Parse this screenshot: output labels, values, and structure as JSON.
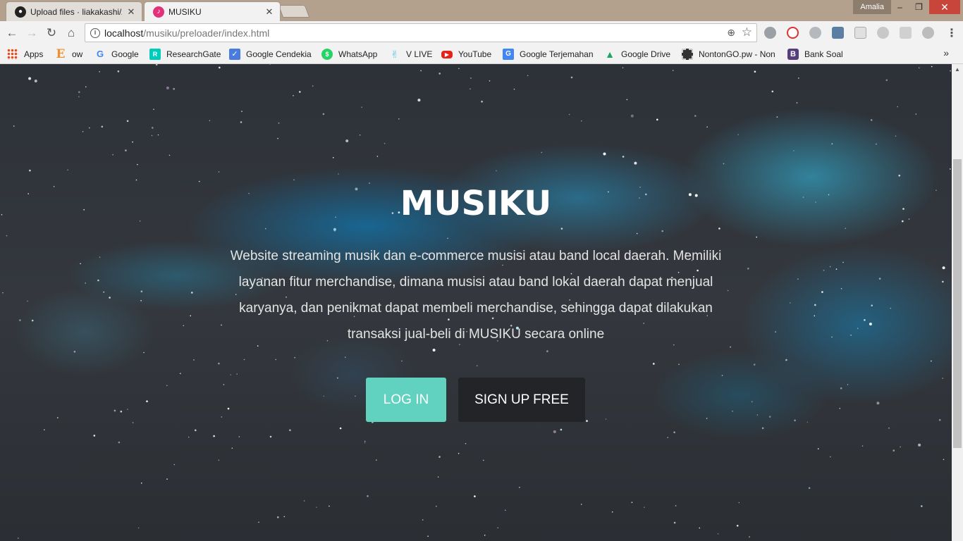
{
  "window": {
    "user": "Amalia",
    "controls": {
      "minimize": "–",
      "maximize": "❐",
      "close": "✕"
    }
  },
  "tabs": [
    {
      "title": "Upload files · liakakashi/A",
      "icon": "github-icon",
      "close": "✕"
    },
    {
      "title": "MUSIKU",
      "icon": "musiku-favicon",
      "close": "✕",
      "active": true
    }
  ],
  "toolbar": {
    "back": "←",
    "forward": "→",
    "reload": "↻",
    "home": "⌂",
    "url_host": "localhost",
    "url_path": "/musiku/preloader/index.html",
    "zoom": "⊕",
    "star": "☆",
    "menu": "⋮"
  },
  "bookmarks": [
    {
      "label": "Apps",
      "icon": "apps-grid-icon",
      "color": "#e64a19"
    },
    {
      "label": "ow",
      "icon": "e-bookmark-icon",
      "color": "#f18f2b"
    },
    {
      "label": "Google",
      "icon": "google-icon",
      "color": "#4285f4"
    },
    {
      "label": "ResearchGate",
      "icon": "researchgate-icon",
      "color": "#00ccbb"
    },
    {
      "label": "Google Cendekia",
      "icon": "google-scholar-icon",
      "color": "#4a7ce0"
    },
    {
      "label": "WhatsApp",
      "icon": "whatsapp-icon",
      "color": "#25d366"
    },
    {
      "label": "V LIVE",
      "icon": "vlive-icon",
      "color": "#58c6e6"
    },
    {
      "label": "YouTube",
      "icon": "youtube-icon",
      "color": "#e62117"
    },
    {
      "label": "Google Terjemahan",
      "icon": "google-translate-icon",
      "color": "#4285f4"
    },
    {
      "label": "Google Drive",
      "icon": "google-drive-icon",
      "color": "#1fa463"
    },
    {
      "label": "NontonGO.pw - Non",
      "icon": "film-icon",
      "color": "#333333"
    },
    {
      "label": "Bank Soal",
      "icon": "bootstrap-icon",
      "color": "#563d7c"
    }
  ],
  "bookmarks_overflow": "»",
  "hero": {
    "title": "MUSIKU",
    "description": "Website streaming musik dan e-commerce musisi atau band local daerah. Memiliki layanan fitur merchandise, dimana musisi atau band lokal daerah dapat menjual karyanya, dan penikmat dapat membeli merchandise, sehingga dapat dilakukan transaksi jual-beli di MUSIKU secara online",
    "login_label": "LOG IN",
    "signup_label": "SIGN UP FREE"
  },
  "colors": {
    "accent": "#62d2c0",
    "signup_bg": "#232428",
    "page_bg": "#2f3338"
  }
}
